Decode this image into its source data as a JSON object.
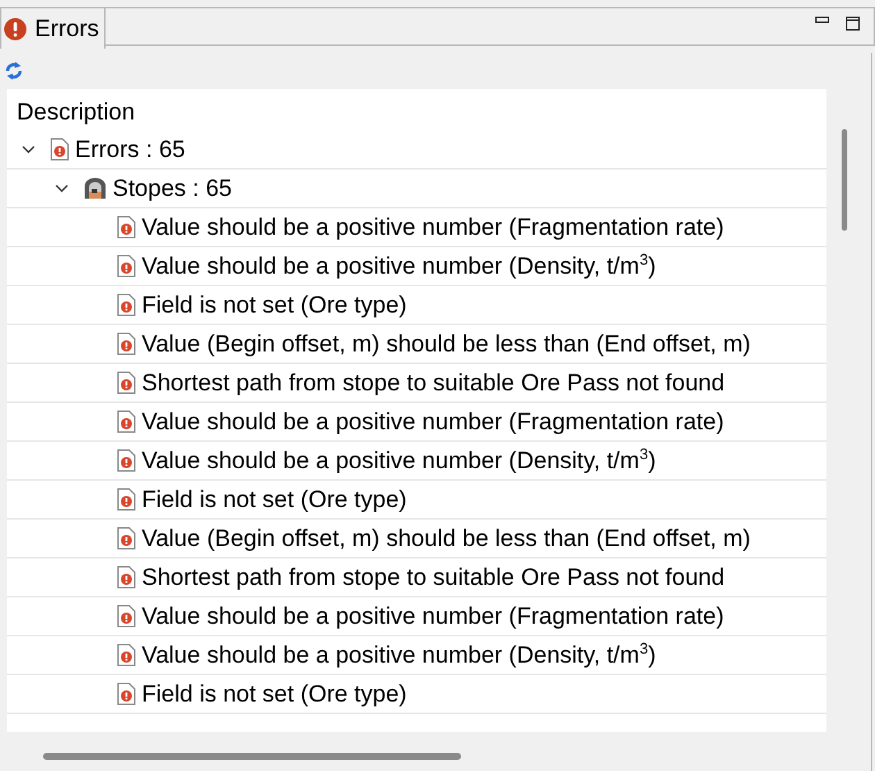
{
  "tab": {
    "label": "Errors",
    "selected": true
  },
  "tree": {
    "column": "Description",
    "items": [
      {
        "kind": "group",
        "label": "Errors : 65",
        "expanded": true,
        "children": [
          {
            "kind": "stopes",
            "label": "Stopes : 65",
            "expanded": true,
            "children": [
              {
                "kind": "error",
                "label": "Value should be a positive number (Fragmentation rate)"
              },
              {
                "kind": "error",
                "label": "Value should be a positive number (Density, t/m$^{3}$)"
              },
              {
                "kind": "error",
                "label": "Field is not set (Ore type)"
              },
              {
                "kind": "error",
                "label": "Value (Begin offset, m) should be less than (End offset, m)"
              },
              {
                "kind": "error",
                "label": "Shortest path from stope to suitable Ore Pass not found"
              },
              {
                "kind": "error",
                "label": "Value should be a positive number (Fragmentation rate)"
              },
              {
                "kind": "error",
                "label": "Value should be a positive number (Density, t/m$^{3}$)"
              },
              {
                "kind": "error",
                "label": "Field is not set (Ore type)"
              },
              {
                "kind": "error",
                "label": "Value (Begin offset, m) should be less than (End offset, m)"
              },
              {
                "kind": "error",
                "label": "Shortest path from stope to suitable Ore Pass not found"
              },
              {
                "kind": "error",
                "label": "Value should be a positive number (Fragmentation rate)"
              },
              {
                "kind": "error",
                "label": "Value should be a positive number (Density, t/m$^{3}$)"
              },
              {
                "kind": "error",
                "label": "Field is not set (Ore type)"
              }
            ]
          }
        ]
      }
    ]
  }
}
